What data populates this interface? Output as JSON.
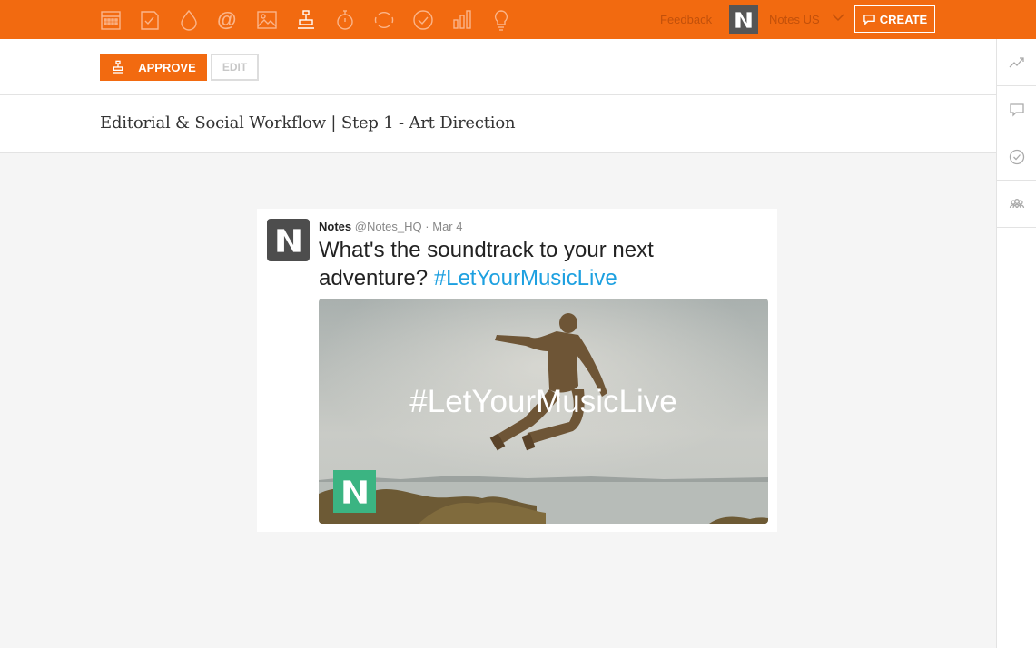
{
  "topbar": {
    "icons": [
      "calendar-icon",
      "checklist-icon",
      "drop-icon",
      "at-icon",
      "image-icon",
      "stamp-icon",
      "stopwatch-icon",
      "cycle-icon",
      "check-circle-icon",
      "bar-chart-icon",
      "lightbulb-icon"
    ],
    "at_glyph": "@",
    "feedback_label": "Feedback",
    "account_name": "Notes US",
    "create_label": "CREATE",
    "accent_color": "#f26a10"
  },
  "toolbar": {
    "approve_label": "APPROVE",
    "edit_label": "EDIT"
  },
  "title": "Editorial & Social Workflow | Step 1 - Art Direction",
  "sidebar": {
    "icons": [
      "trend-icon",
      "comment-icon",
      "check-circle-icon",
      "team-icon"
    ]
  },
  "tweet": {
    "name": "Notes",
    "handle": "@Notes_HQ",
    "separator": "·",
    "date": "Mar 4",
    "text": "What's the soundtrack to your next adventure?",
    "hashtag": "#LetYourMusicLive",
    "media_text": "#LetYourMusicLive",
    "hashtag_color": "#1da0e0",
    "logo_color": "#3bb482"
  }
}
